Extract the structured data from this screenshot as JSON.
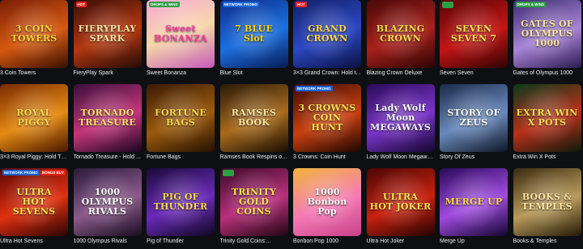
{
  "games": [
    {
      "title": "3 Coin Towers",
      "art": "3 COIN TOWERS",
      "bg": "linear-gradient(160deg,#7a1e06,#d6590f 55%,#3a1004)",
      "fg": "#ffd23a",
      "badges": []
    },
    {
      "title": "FieryPlay Spark",
      "art": "FIERYPLAY SPARK",
      "bg": "linear-gradient(160deg,#3a0c06,#b3370f 55%,#220a06)",
      "fg": "#ffe2a0",
      "badges": [
        {
          "text": "HOT",
          "color": "#e3241b"
        }
      ]
    },
    {
      "title": "Sweet Bonanza",
      "art": "Sweet BONANZA",
      "bg": "linear-gradient(160deg,#f6a9d6,#f7d7a8 50%,#c45bb8)",
      "fg": "#ff3ca8",
      "badges": [
        {
          "text": "DROPS & WINS",
          "color": "#2e9e46"
        }
      ]
    },
    {
      "title": "Blue Slot",
      "art": "7 BLUE Slot",
      "bg": "linear-gradient(160deg,#0b2c88,#1c6fe0 55%,#081a54)",
      "fg": "#ffd400",
      "badges": [
        {
          "text": "NETWORK PROMO",
          "color": "#1a62d6"
        }
      ]
    },
    {
      "title": "3×3 Grand Crown: Hold t...",
      "art": "GRAND CROWN",
      "bg": "linear-gradient(160deg,#13206a,#2b47c2 55%,#0a1142)",
      "fg": "#ffd84a",
      "badges": [
        {
          "text": "HOT",
          "color": "#e3241b"
        }
      ]
    },
    {
      "title": "Blazing Crown Deluxe",
      "art": "BLAZING CROWN",
      "bg": "linear-gradient(160deg,#4a0808,#a8201a 55%,#2a0404)",
      "fg": "#ffd84a",
      "badges": []
    },
    {
      "title": "Seven Seven",
      "art": "SEVEN SEVEN 7",
      "bg": "linear-gradient(160deg,#5a0606,#c31414 55%,#300303)",
      "fg": "#ffe14f",
      "badges": [
        {
          "text": "",
          "color": "#2e9e46"
        }
      ]
    },
    {
      "title": "Gates of Olympus 1000",
      "art": "GATES OF OLYMPUS 1000",
      "bg": "linear-gradient(160deg,#3b2a6e,#a884d6 55%,#2b1a52)",
      "fg": "#ffe79a",
      "badges": [
        {
          "text": "DROPS & WINS",
          "color": "#2e9e46"
        }
      ]
    },
    {
      "title": "3×3 Royal Piggy: Hold Th...",
      "art": "ROYAL PIGGY",
      "bg": "linear-gradient(160deg,#7a2a00,#e58a12 55%,#4a1800)",
      "fg": "#ffd84a",
      "badges": []
    },
    {
      "title": "Tornado Treasure - Hold ...",
      "art": "TORNADO TREASURE",
      "bg": "linear-gradient(160deg,#3a0f3a,#c4357a 55%,#1a0620)",
      "fg": "#ffe06a",
      "badges": []
    },
    {
      "title": "Fortune Bags",
      "art": "FORTUNE BAGS",
      "bg": "linear-gradient(160deg,#3a1a04,#9a5a0c 55%,#241002)",
      "fg": "#ffd84a",
      "badges": []
    },
    {
      "title": "Ramses Book Respins of...",
      "art": "RAMSES BOOK",
      "bg": "linear-gradient(160deg,#2a1a0a,#a86a1c 55%,#1a0e04)",
      "fg": "#ffe6a0",
      "badges": []
    },
    {
      "title": "3 Crowns: Coin Hunt",
      "art": "3 CROWNS COIN HUNT",
      "bg": "linear-gradient(160deg,#3a0a04,#c8400e 55%,#1e0602)",
      "fg": "#ffe14f",
      "badges": [
        {
          "text": "NETWORK PROMO",
          "color": "#1a62d6"
        }
      ]
    },
    {
      "title": "Lady Wolf Moon Megaways",
      "art": "Lady Wolf Moon MEGAWAYS",
      "bg": "linear-gradient(160deg,#2a0a5a,#7a34c8 55%,#14052e)",
      "fg": "#ffffff",
      "badges": []
    },
    {
      "title": "Story Of Zeus",
      "art": "STORY OF ZEUS",
      "bg": "linear-gradient(160deg,#1a2a4a,#6a8abc 55%,#0e1626)",
      "fg": "#ffffff",
      "badges": []
    },
    {
      "title": "Extra Win X Pots",
      "art": "EXTRA WIN X POTS",
      "bg": "linear-gradient(160deg,#0a3a1a,#b8301a 55%,#0a1a0a)",
      "fg": "#ffe14f",
      "badges": []
    },
    {
      "title": "Ultra Hot Sevens",
      "art": "ULTRA HOT SEVENS",
      "bg": "linear-gradient(160deg,#5a0604,#e03010 55%,#2a0302)",
      "fg": "#ffe14f",
      "badges": [
        {
          "text": "NETWORK PROMO",
          "color": "#1a62d6"
        },
        {
          "text": "BONUS BUY",
          "color": "#e3241b"
        }
      ]
    },
    {
      "title": "1000 Olympus Rivals",
      "art": "1000 OLYMPUS RIVALS",
      "bg": "linear-gradient(160deg,#2a1a3a,#8a5a8a 55%,#180c20)",
      "fg": "#ffffff",
      "badges": []
    },
    {
      "title": "Pig of Thunder",
      "art": "PIG OF THUNDER",
      "bg": "linear-gradient(160deg,#1a0a3a,#6a2ab8 55%,#0e0620)",
      "fg": "#ffd84a",
      "badges": []
    },
    {
      "title": "Trinity Gold Coins:...",
      "art": "TRINITY GOLD COINS",
      "bg": "linear-gradient(160deg,#3a0a2a,#b8307a 55%,#200614)",
      "fg": "#ffe14f",
      "badges": [
        {
          "text": "",
          "color": "#2e9e46"
        }
      ]
    },
    {
      "title": "Bonbon Pop 1000",
      "art": "1000 Bonbon Pop",
      "bg": "linear-gradient(160deg,#f2b43a,#f47ab4 55%,#c8408a)",
      "fg": "#ffffff",
      "badges": []
    },
    {
      "title": "Ultra Hot Joker",
      "art": "ULTRA HOT JOKER",
      "bg": "linear-gradient(160deg,#4a0604,#c8200e 55%,#220302)",
      "fg": "#ffe14f",
      "badges": []
    },
    {
      "title": "Merge Up",
      "art": "MERGE UP",
      "bg": "linear-gradient(160deg,#2a0a5a,#a04ae0 55%,#14052e)",
      "fg": "#ffd84a",
      "badges": []
    },
    {
      "title": "Books & Temples",
      "art": "BOOKS & TEMPLES",
      "bg": "linear-gradient(160deg,#3a2a10,#b89a5a 55%,#241808)",
      "fg": "#ffe6a0",
      "badges": []
    }
  ]
}
